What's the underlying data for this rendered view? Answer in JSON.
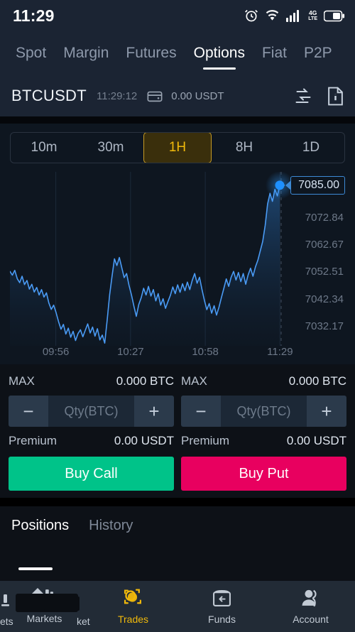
{
  "status_bar": {
    "time": "11:29",
    "icons": [
      "alarm-clock-icon",
      "wifi-icon",
      "signal-bars-icon",
      "lte-icon",
      "battery-icon"
    ],
    "network_label": "4G",
    "network_sub": "LTE"
  },
  "top_tabs": [
    {
      "label": "Spot",
      "active": false
    },
    {
      "label": "Margin",
      "active": false
    },
    {
      "label": "Futures",
      "active": false
    },
    {
      "label": "Options",
      "active": true
    },
    {
      "label": "Fiat",
      "active": false
    },
    {
      "label": "P2P",
      "active": false
    }
  ],
  "symbol_header": {
    "symbol": "BTCUSDT",
    "time": "11:29:12",
    "balance": "0.00 USDT",
    "wallet_icon": "wallet-icon",
    "transfer_icon": "transfer-arrows-icon",
    "info_icon": "info-document-icon"
  },
  "timeframes": [
    {
      "label": "10m",
      "active": false
    },
    {
      "label": "30m",
      "active": false
    },
    {
      "label": "1H",
      "active": true
    },
    {
      "label": "8H",
      "active": false
    },
    {
      "label": "1D",
      "active": false
    }
  ],
  "chart_data": {
    "type": "line",
    "title": "BTCUSDT 1H price chart",
    "xlabel": "",
    "ylabel": "",
    "current_price": "7085.00",
    "current_price_value": 7085.0,
    "grid": true,
    "legend": "none",
    "x_tick_labels": [
      "09:56",
      "10:27",
      "10:58",
      "11:29"
    ],
    "y_tick_labels": [
      "7085.00",
      "7072.84",
      "7062.67",
      "7052.51",
      "7042.34",
      "7032.17"
    ],
    "ylim": [
      7025.0,
      7090.0
    ],
    "line_color": "#4a9bf5",
    "fill_color": "#17375e",
    "marker_color": "#1e90ff",
    "x": [
      0,
      1,
      2,
      3,
      4,
      5,
      6,
      7,
      8,
      9,
      10,
      11,
      12,
      13,
      14,
      15,
      16,
      17,
      18,
      19,
      20,
      21,
      22,
      23,
      24,
      25,
      26,
      27,
      28,
      29,
      30,
      31,
      32,
      33,
      34,
      35,
      36,
      37,
      38,
      39,
      40,
      41,
      42,
      43,
      44,
      45,
      46,
      47,
      48,
      49,
      50,
      51,
      52,
      53,
      54,
      55,
      56,
      57,
      58,
      59,
      60,
      61,
      62,
      63,
      64,
      65,
      66,
      67,
      68,
      69,
      70,
      71,
      72,
      73,
      74,
      75,
      76,
      77,
      78,
      79,
      80,
      81,
      82,
      83,
      84,
      85,
      86,
      87,
      88,
      89,
      90,
      91,
      92,
      93,
      94,
      95,
      96,
      97,
      98,
      99,
      100,
      101,
      102,
      103,
      104,
      105,
      106,
      107,
      108,
      109,
      110
    ],
    "values": [
      7052.8,
      7051.4,
      7053.2,
      7050.1,
      7048.6,
      7051.0,
      7047.9,
      7049.4,
      7046.2,
      7048.0,
      7045.1,
      7046.8,
      7044.0,
      7046.0,
      7043.2,
      7044.8,
      7041.0,
      7038.6,
      7040.2,
      7037.4,
      7034.0,
      7031.2,
      7033.0,
      7029.4,
      7031.6,
      7028.2,
      7030.4,
      7027.0,
      7029.6,
      7031.0,
      7028.4,
      7030.8,
      7033.2,
      7029.8,
      7032.0,
      7028.6,
      7031.4,
      7027.2,
      7029.0,
      7026.0,
      7034.5,
      7044.0,
      7051.0,
      7057.5,
      7055.0,
      7058.0,
      7054.2,
      7050.5,
      7052.0,
      7047.6,
      7044.0,
      7039.8,
      7036.0,
      7040.4,
      7043.0,
      7046.5,
      7044.0,
      7047.2,
      7043.6,
      7046.0,
      7041.8,
      7044.5,
      7040.2,
      7042.6,
      7039.0,
      7041.5,
      7043.8,
      7047.0,
      7044.5,
      7047.8,
      7045.0,
      7048.2,
      7045.6,
      7048.8,
      7046.0,
      7049.5,
      7052.0,
      7048.4,
      7050.6,
      7046.0,
      7042.0,
      7038.5,
      7040.8,
      7037.2,
      7040.0,
      7036.5,
      7039.4,
      7043.0,
      7046.5,
      7050.0,
      7047.2,
      7050.6,
      7052.8,
      7049.6,
      7052.4,
      7049.0,
      7052.0,
      7048.0,
      7051.5,
      7054.0,
      7051.0,
      7054.5,
      7057.0,
      7060.5,
      7064.0,
      7070.0,
      7078.0,
      7082.0,
      7079.0,
      7083.5,
      7081.0,
      7085.0
    ]
  },
  "trade_panel": {
    "call": {
      "max_label": "MAX",
      "max_value": "0.000 BTC",
      "decrement": "−",
      "increment": "+",
      "qty_placeholder": "Qty(BTC)",
      "qty_value": "",
      "premium_label": "Premium",
      "premium_value": "0.00 USDT",
      "action_label": "Buy Call",
      "action_color": "#00c389"
    },
    "put": {
      "max_label": "MAX",
      "max_value": "0.000 BTC",
      "decrement": "−",
      "increment": "+",
      "qty_placeholder": "Qty(BTC)",
      "qty_value": "",
      "premium_label": "Premium",
      "premium_value": "0.00 USDT",
      "action_label": "Buy Put",
      "action_color": "#e8005f"
    }
  },
  "position_tabs": [
    {
      "label": "Positions",
      "active": true
    },
    {
      "label": "History",
      "active": false
    }
  ],
  "bottom_nav": {
    "glitch_fragment_left": "ets",
    "glitch_fragment_mid": "ket",
    "items": [
      {
        "label": "Markets",
        "icon": "bar-chart-icon",
        "active": false
      },
      {
        "label": "Trades",
        "icon": "trades-circle-icon",
        "active": true
      },
      {
        "label": "Funds",
        "icon": "funds-briefcase-icon",
        "active": false
      },
      {
        "label": "Account",
        "icon": "account-person-icon",
        "active": false
      }
    ]
  },
  "colors": {
    "accent_gold": "#f0b90b",
    "call_green": "#00c389",
    "put_pink": "#e8005f",
    "chart_blue": "#4a9bf5",
    "header_bg": "#1b2433",
    "page_bg": "#0d1117"
  }
}
